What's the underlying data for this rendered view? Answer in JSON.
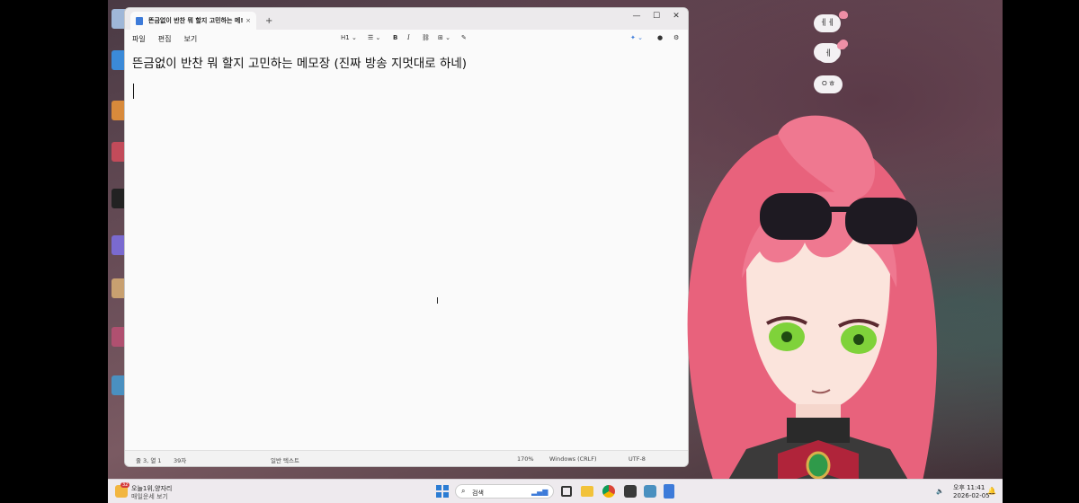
{
  "window": {
    "tab_title": "뜬금없이 반찬 뭐 할지 고민하는 메!",
    "tab_close": "×",
    "new_tab": "+",
    "minimize": "—",
    "maximize": "☐",
    "close": "✕"
  },
  "menu": {
    "file": "파일",
    "edit": "편집",
    "view": "보기"
  },
  "toolbar": {
    "heading": "H1",
    "bold": "B",
    "italic": "I"
  },
  "document": {
    "text": "뜬금없이 반찬 뭐 할지 고민하는 메모장 (진짜 방송 지멋대로 하네)"
  },
  "status": {
    "position": "줄 3, 열 1",
    "chars": "39자",
    "format": "일반 텍스트",
    "zoom": "170%",
    "line_ending": "Windows (CRLF)",
    "encoding": "UTF-8"
  },
  "chat": [
    "ㅔㅔ",
    "ㅔ",
    "ㅔ",
    "ㅇㅎ"
  ],
  "taskbar": {
    "widget_line1": "오늘1위,양자리",
    "widget_line2": "매일운세 보기",
    "widget_badge": "32",
    "search_placeholder": "검색",
    "clock_time": "오후 11:41",
    "clock_date": "2026-02-05"
  },
  "colors": {
    "accent": "#3d7bd9",
    "hair": "#ee6f86",
    "editor_bg": "#fafafa"
  }
}
